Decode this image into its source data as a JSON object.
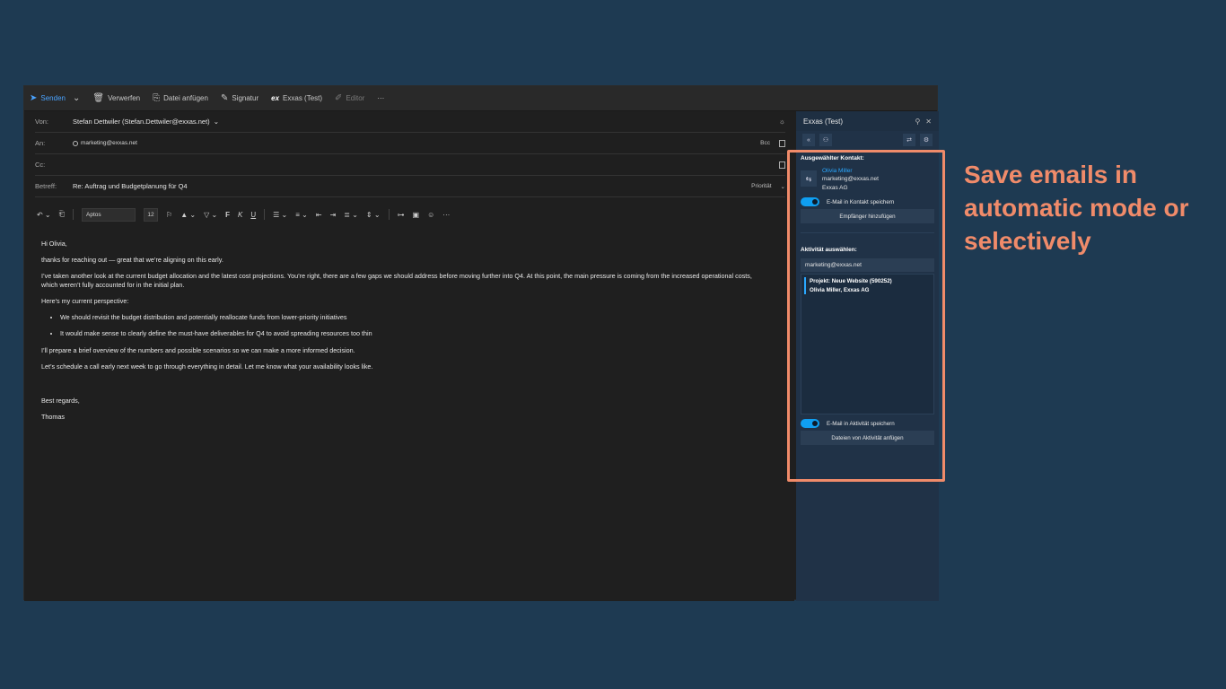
{
  "toolbar": {
    "send": "Senden",
    "discard": "Verwerfen",
    "attach": "Datei anfügen",
    "signature": "Signatur",
    "addin": "Exxas (Test)",
    "addin_logo": "ex",
    "editor": "Editor",
    "more": "···"
  },
  "fields": {
    "from_label": "Von:",
    "from_value": "Stefan Dettwiler (Stefan.Dettwiler@exxas.net)",
    "to_label": "An:",
    "to_value": "marketing@exxas.net",
    "bcc": "Bcc",
    "cc_label": "Cc:",
    "subject_label": "Betreff:",
    "subject_value": "Re: Auftrag und Budgetplanung für Q4",
    "priority": "Priorität"
  },
  "format": {
    "font": "Aptos",
    "size": "12"
  },
  "email_body": {
    "greeting": "Hi Olivia,",
    "p1": "thanks for reaching out — great that we’re aligning on this early.",
    "p2": "I’ve taken another look at the current budget allocation and the latest cost projections. You’re right, there are a few gaps we should address before moving further into Q4. At this point, the main pressure is coming from the increased operational costs, which weren’t fully accounted for in the initial plan.",
    "p3": "Here’s my current perspective:",
    "bullets": [
      "We should revisit the budget distribution and potentially reallocate funds from lower-priority initiatives",
      "It would make sense to clearly define the must-have deliverables for Q4 to avoid spreading resources too thin"
    ],
    "p4": "I’ll prepare a brief overview of the numbers and possible scenarios so we can make a more informed decision.",
    "p5": "Let’s schedule a call early next week to go through everything in detail. Let me know what your availability looks like.",
    "closing": "Best regards,",
    "signature": "Thomas"
  },
  "pane": {
    "title": "Exxas (Test)",
    "contact_title": "Ausgewählter Kontakt:",
    "contact_name": "Olivia Miller",
    "contact_email": "marketing@exxas.net",
    "contact_company": "Exxas AG",
    "save_contact_toggle": "E-Mail in Kontakt speichern",
    "add_recipient": "Empfänger hinzufügen",
    "activity_title": "Aktivität auswählen:",
    "activity_select": "marketing@exxas.net",
    "activity_project": "Projekt: Neue Website (590252)",
    "activity_people": "Olivia Miller, Exxas AG",
    "save_activity_toggle": "E-Mail in Aktivität speichern",
    "attach_files": "Dateien von Aktivität anfügen"
  },
  "callout": "Save emails in automatic mode or selectively",
  "colors": {
    "accent": "#f08b6a",
    "link": "#2aa8ff",
    "toggle": "#0f9ff2",
    "background": "#1e3a52"
  }
}
